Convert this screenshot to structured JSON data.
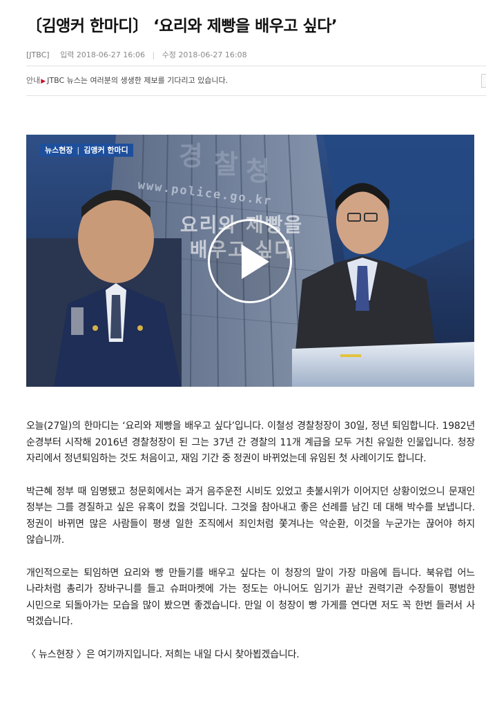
{
  "article": {
    "title": "〔김앵커 한마디〕 ‘요리와 제빵을 배우고 싶다’",
    "source": "[JTBC]",
    "input_label": "입력",
    "input_time": "2018-06-27 16:06",
    "edit_label": "수정",
    "edit_time": "2018-06-27 16:08",
    "paragraphs": [
      "오늘(27일)의 한마디는 ‘요리와 제빵을 배우고 싶다’입니다. 이철성 경찰청장이 30일, 정년 퇴임합니다. 1982년 순경부터 시작해 2016년 경찰청장이 된 그는 37년 간 경찰의 11개 계급을 모두 거친 유일한 인물입니다. 청장 자리에서 정년퇴임하는 것도 처음이고, 재임 기간 중 정권이 바뀌었는데 유임된 첫 사례이기도 합니다.",
      "박근혜 정부 때 임명됐고 청문회에서는 과거 음주운전 시비도 있었고 촛불시위가 이어지던 상황이었으니 문재인 정부는 그를 경질하고 싶은 유혹이 컸을 것입니다. 그것을 참아내고 좋은 선례를 남긴 데 대해 박수를 보냅니다. 정권이 바뀌면 많은 사람들이 평생 일한 조직에서 죄인처럼 쫓겨나는 악순환, 이것을 누군가는 끊어야 하지 않습니까.",
      "개인적으로는 퇴임하면 요리와 빵 만들기를 배우고 싶다는 이 청장의 말이 가장 마음에 듭니다. 북유럽 어느 나라처럼 총리가 장바구니를 들고 슈퍼마켓에 가는 정도는 아니어도 임기가 끝난 권력기관 수장들이 평범한 시민으로 되돌아가는 모습을 많이 봤으면 좋겠습니다. 만일 이 청장이 빵 가게를 연다면 저도 꼭 한번 들러서 사 먹겠습니다.",
      "〈 뉴스현장 〉은 여기까지입니다. 저희는 내일 다시 찾아뵙겠습니다."
    ]
  },
  "notice": {
    "label": "안내",
    "text": "JTBC 뉴스는 여러분의 생생한 제보를 기다리고 있습니다."
  },
  "video": {
    "badge_program": "뉴스현장",
    "badge_sep": "|",
    "badge_segment": "김앵커 한마디",
    "overlay_line1": "요리와 제빵을",
    "overlay_line2": "배우고 싶다",
    "url_text": "www.police.go.kr",
    "building_chars": [
      "경",
      "찰",
      "청"
    ],
    "play_icon": "play-icon"
  },
  "colors": {
    "badge_blue": "#1d4f9c",
    "notice_arrow": "#c8102e"
  }
}
